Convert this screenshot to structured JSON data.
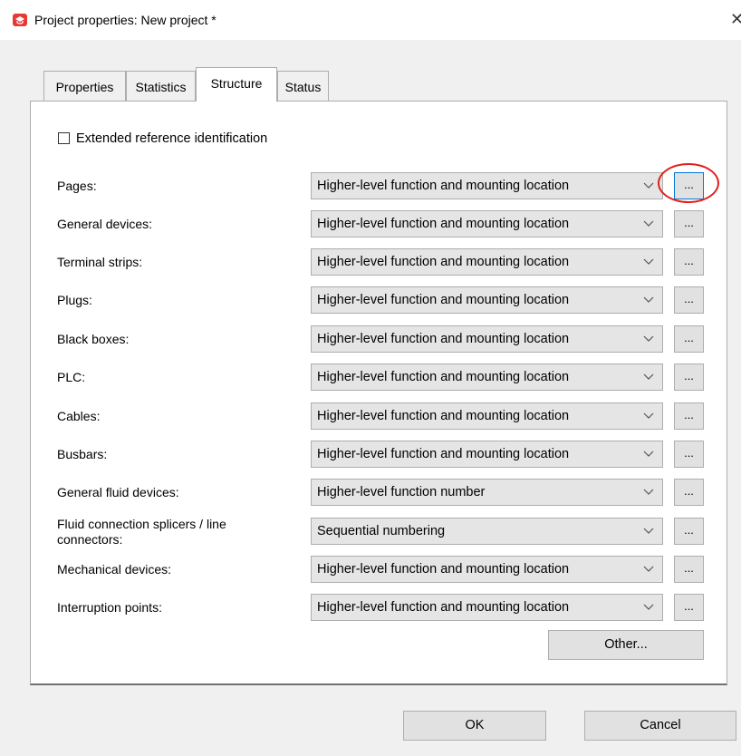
{
  "window": {
    "title": "Project properties: New project *",
    "close_glyph": "✕"
  },
  "tabs": [
    "Properties",
    "Statistics",
    "Structure",
    "Status"
  ],
  "active_tab": "Structure",
  "checkbox": {
    "label": "Extended reference identification",
    "checked": false
  },
  "rows": [
    {
      "label": "Pages:",
      "value": "Higher-level function and mounting location"
    },
    {
      "label": "General devices:",
      "value": "Higher-level function and mounting location"
    },
    {
      "label": "Terminal strips:",
      "value": "Higher-level function and mounting location"
    },
    {
      "label": "Plugs:",
      "value": "Higher-level function and mounting location"
    },
    {
      "label": "Black boxes:",
      "value": "Higher-level function and mounting location"
    },
    {
      "label": "PLC:",
      "value": "Higher-level function and mounting location"
    },
    {
      "label": "Cables:",
      "value": "Higher-level function and mounting location"
    },
    {
      "label": "Busbars:",
      "value": "Higher-level function and mounting location"
    },
    {
      "label": "General fluid devices:",
      "value": "Higher-level function number"
    },
    {
      "label": "Fluid connection splicers / line connectors:",
      "value": "Sequential numbering"
    },
    {
      "label": "Mechanical devices:",
      "value": "Higher-level function and mounting location"
    },
    {
      "label": "Interruption points:",
      "value": "Higher-level function and mounting location"
    }
  ],
  "browse_label": "...",
  "buttons": {
    "other": "Other...",
    "ok": "OK",
    "cancel": "Cancel"
  },
  "colors": {
    "accent_red": "#e02020",
    "focus_blue": "#0078d7"
  }
}
